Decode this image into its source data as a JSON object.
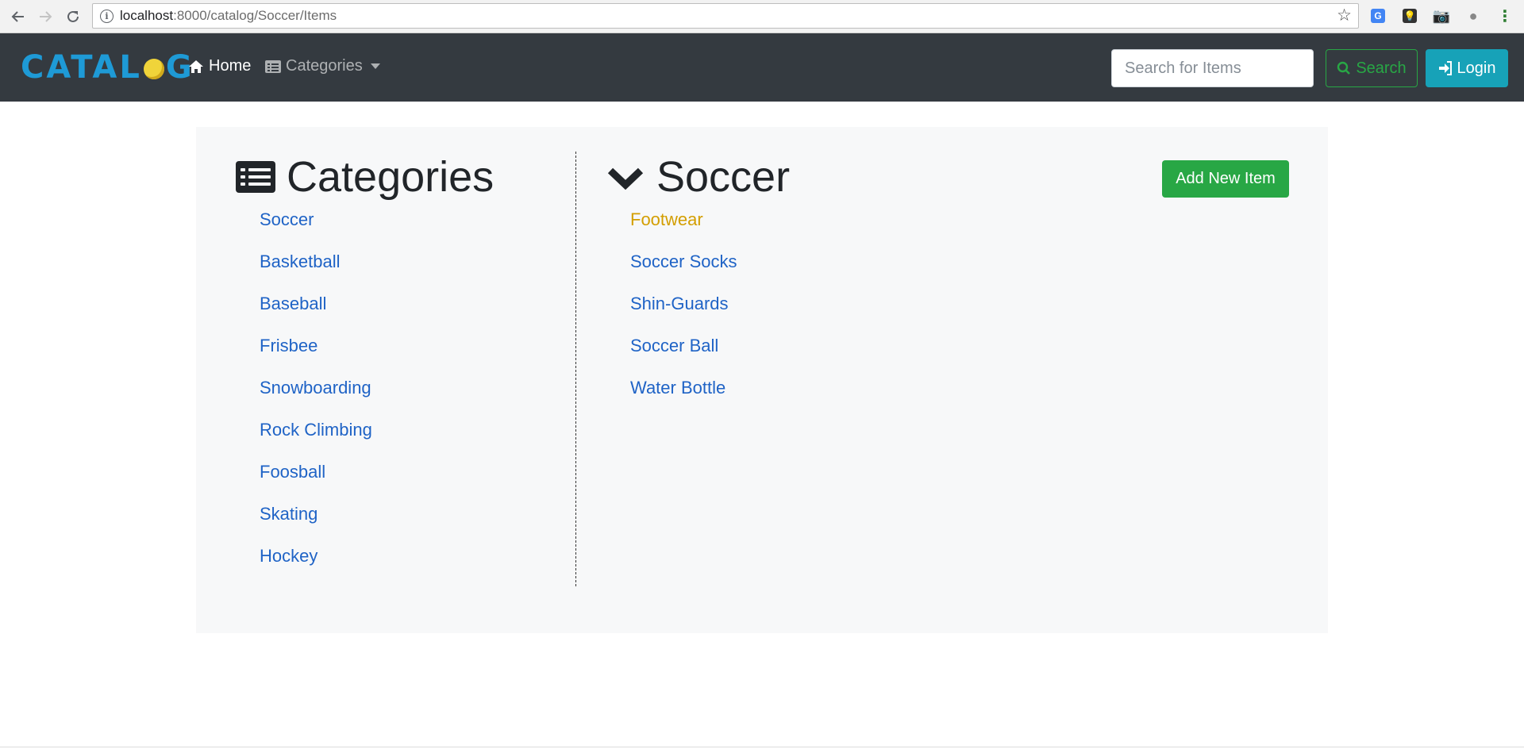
{
  "browser": {
    "url_host": "localhost",
    "url_path": ":8000/catalog/Soccer/Items"
  },
  "navbar": {
    "brand_left": "CATAL",
    "brand_right": "G",
    "home_label": "Home",
    "categories_label": "Categories",
    "search_placeholder": "Search for Items",
    "search_button_label": "Search",
    "login_button_label": "Login",
    "colors": {
      "background": "#343a40",
      "brand": "#1e9ad6",
      "search_button": "#28a745",
      "login_button": "#17a2b8"
    }
  },
  "sidebar": {
    "title": "Categories",
    "items": [
      {
        "label": "Soccer"
      },
      {
        "label": "Basketball"
      },
      {
        "label": "Baseball"
      },
      {
        "label": "Frisbee"
      },
      {
        "label": "Snowboarding"
      },
      {
        "label": "Rock Climbing"
      },
      {
        "label": "Foosball"
      },
      {
        "label": "Skating"
      },
      {
        "label": "Hockey"
      }
    ]
  },
  "main": {
    "title": "Soccer",
    "add_button_label": "Add New Item",
    "items": [
      {
        "label": "Footwear",
        "active": true
      },
      {
        "label": "Soccer Socks"
      },
      {
        "label": "Shin-Guards"
      },
      {
        "label": "Soccer Ball"
      },
      {
        "label": "Water Bottle"
      }
    ],
    "colors": {
      "link": "#1f63c6",
      "active_link": "#d39e00",
      "add_button": "#28a745"
    }
  },
  "icons": {
    "back": "arrow-left-icon",
    "forward": "arrow-right-icon",
    "reload": "reload-icon",
    "info": "info-icon",
    "bookmark": "star-icon",
    "home": "home-icon",
    "categories": "list-alt-icon",
    "search": "search-icon",
    "login": "sign-in-icon",
    "section_categories": "list-alt-icon",
    "section_soccer": "chevron-down-icon"
  }
}
